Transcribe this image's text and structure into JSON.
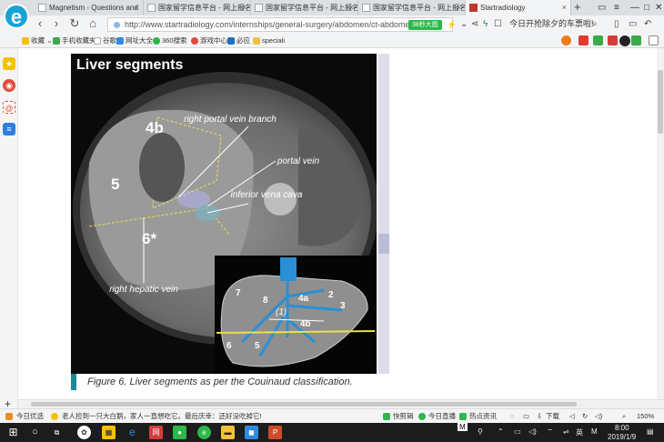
{
  "browser": {
    "logo_letter": "e",
    "tabs": [
      {
        "title": "Magnetism - Questions and",
        "active": false
      },
      {
        "title": "国家留学信息平台 - 网上报名",
        "active": false
      },
      {
        "title": "国家留学信息平台 - 网上报名",
        "active": false
      },
      {
        "title": "国家留学信息平台 - 网上报名",
        "active": false
      },
      {
        "title": "Startradiology",
        "active": true
      }
    ],
    "new_tab": "+",
    "url": "http://www.startradiology.com/internships/general-surgery/abdomen/ct-abdomen-g",
    "promo_badge": "38秒大图",
    "hot_search": "今日开抢除夕的车票啦!",
    "bookmarks": [
      "收藏",
      "手机收藏夹",
      "谷歌",
      "网址大全",
      "360搜索",
      "游戏中心",
      "必应",
      "speciali"
    ]
  },
  "figure": {
    "title": "Liver segments",
    "labels": {
      "right_portal_vein_branch": "right portal vein branch",
      "portal_vein": "portal vein",
      "inferior_vena_cava": "inferior vena cava",
      "right_hepatic_vein": "right hepatic vein"
    },
    "segments_main": [
      "4b",
      "5",
      "6*"
    ],
    "segments_inset": [
      "7",
      "8",
      "4a",
      "2",
      "3",
      "(1)",
      "4b",
      "6",
      "5"
    ],
    "caption": "Figure 6. Liver segments as per the Couinaud classification."
  },
  "statusbar": {
    "left_label": "今日优选",
    "news": "老人捡到一只大白鹅，家人一直想吃它。最后庆幸：还好没吃掉它!",
    "right_items": [
      "快剪辑",
      "今日直播",
      "热点资讯",
      "下载"
    ],
    "zoom": "150%"
  },
  "taskbar": {
    "time": "8:00",
    "date": "2019/1/9",
    "lang": "英",
    "ime": "M"
  },
  "colors": {
    "accent": "#17a3d8",
    "caption_bar": "#1a8a95",
    "promo_green": "#2cb84a",
    "vein_blue": "#2a8fd6",
    "segment_yellow": "#e8e24a"
  }
}
